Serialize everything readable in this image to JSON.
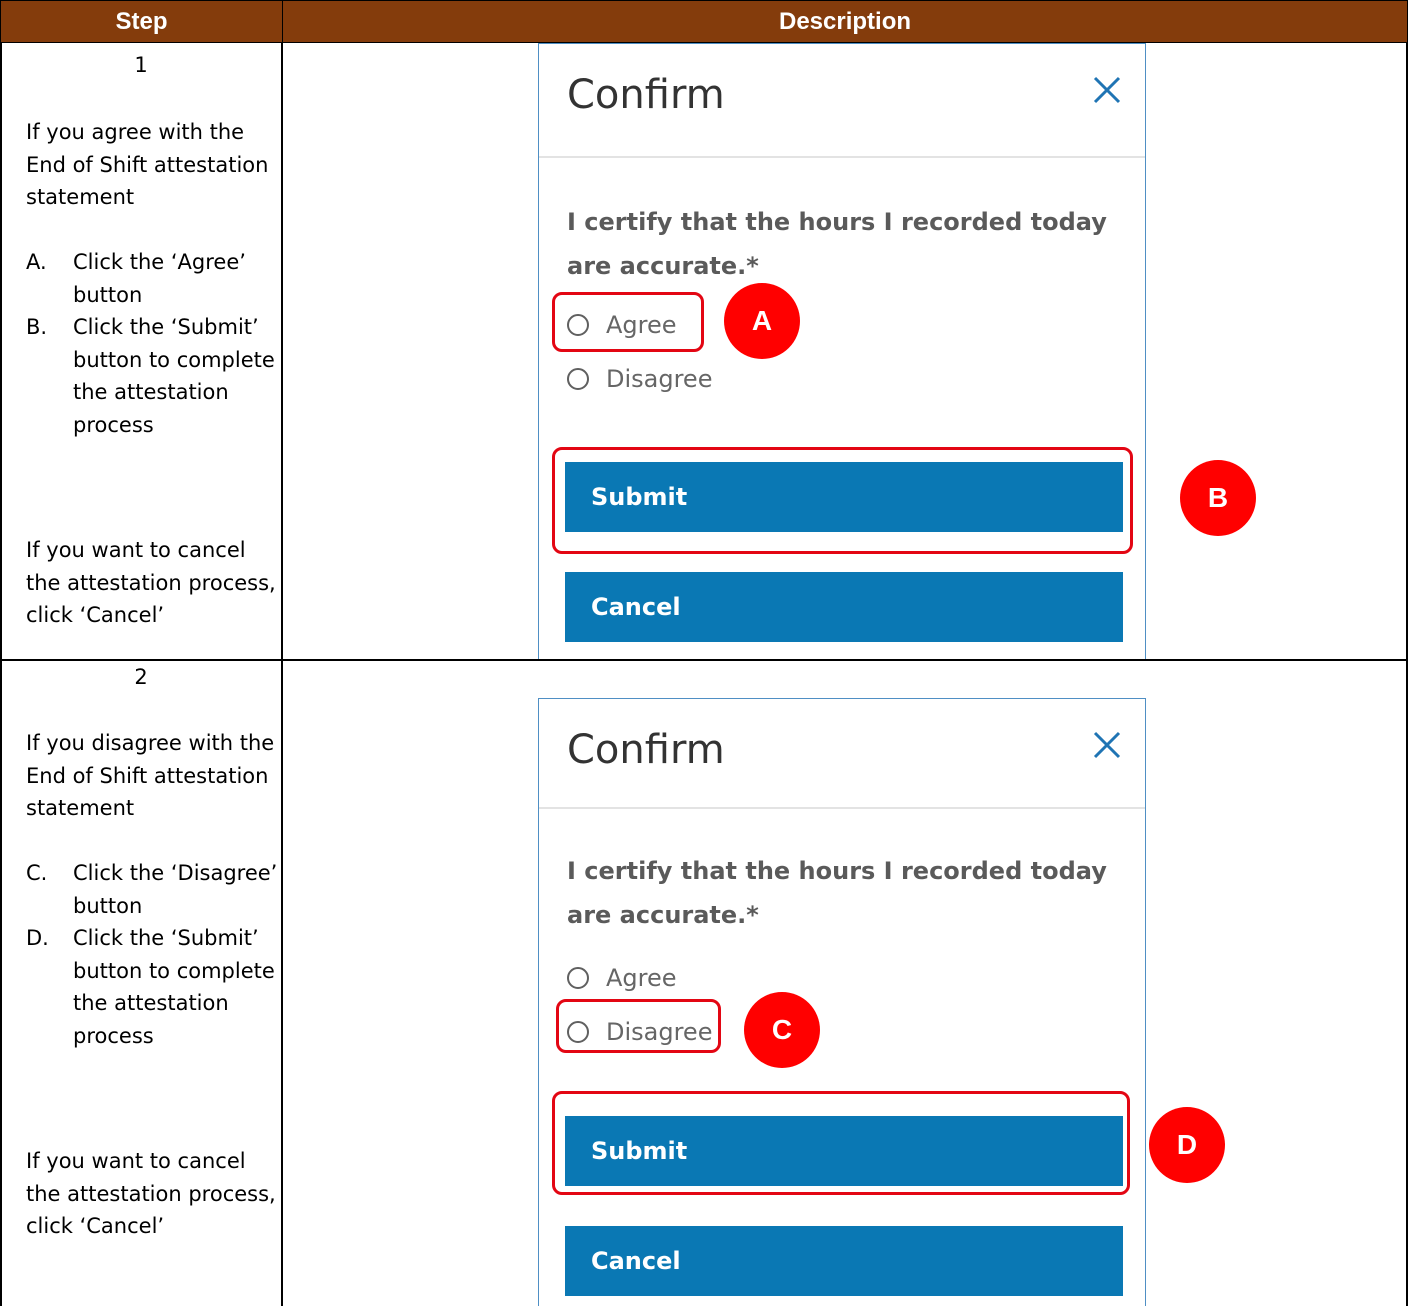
{
  "table": {
    "headers": {
      "step": "Step",
      "description": "Description"
    }
  },
  "steps": [
    {
      "number": "1",
      "intro": "If you agree with the End of Shift attestation statement",
      "items": [
        {
          "marker": "A.",
          "text": "Click the ‘Agree’ button"
        },
        {
          "marker": "B.",
          "text": "Click the ‘Submit’ button to complete the attestation process"
        }
      ],
      "cancel_note": "If you want to cancel the attestation process, click ‘Cancel’",
      "callouts": [
        "A",
        "B"
      ]
    },
    {
      "number": "2",
      "intro": "If you disagree with the End of Shift attestation statement",
      "items": [
        {
          "marker": "C.",
          "text": "Click the ‘Disagree’ button"
        },
        {
          "marker": "D.",
          "text": "Click the ‘Submit’ button to complete the attestation process"
        }
      ],
      "cancel_note": "If you want to cancel the attestation process, click ‘Cancel’",
      "callouts": [
        "C",
        "D"
      ]
    }
  ],
  "dialog": {
    "title": "Confirm",
    "close_icon": "close-x-icon",
    "question": "I certify that the hours I recorded today are accurate.*",
    "options": [
      "Agree",
      "Disagree"
    ],
    "submit_label": "Submit",
    "cancel_label": "Cancel"
  },
  "colors": {
    "header_bg": "#843c0c",
    "button_bg": "#0a78b4",
    "callout_red": "#ff0000",
    "dialog_border": "#4f8fc4"
  }
}
